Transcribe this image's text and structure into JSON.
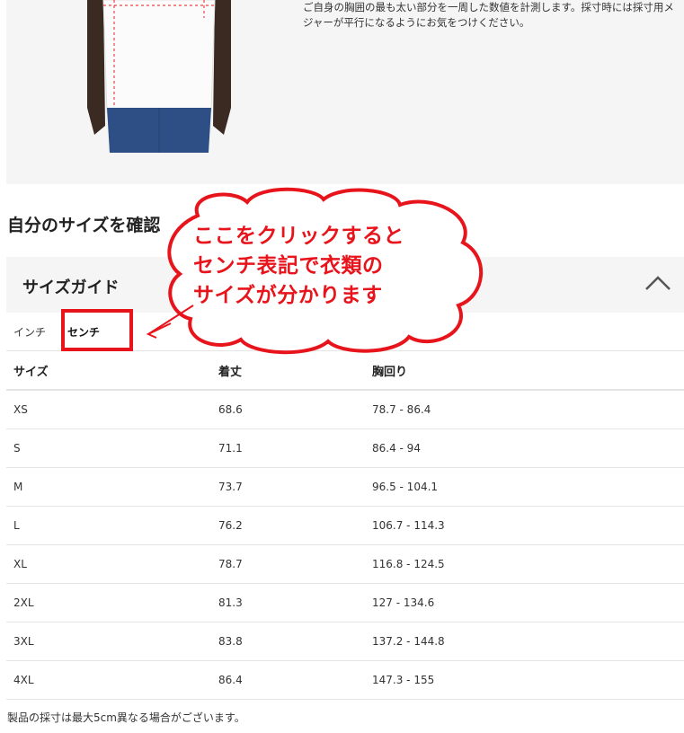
{
  "measure_instructions": "ご自身の胸囲の最も太い部分を一周した数値を計測します。採寸時には採寸用メジャーが平行になるようにお気をつけください。",
  "section_title": "自分のサイズを確認",
  "size_guide": {
    "title": "サイズガイド",
    "collapse_icon": "chevron-up-icon",
    "tabs": [
      "インチ",
      "センチ"
    ],
    "selected_tab": "センチ",
    "columns": [
      "サイズ",
      "着丈",
      "胸回り"
    ],
    "rows": [
      [
        "XS",
        "68.6",
        "78.7 - 86.4"
      ],
      [
        "S",
        "71.1",
        "86.4 - 94"
      ],
      [
        "M",
        "73.7",
        "96.5 - 104.1"
      ],
      [
        "L",
        "76.2",
        "106.7 - 114.3"
      ],
      [
        "XL",
        "78.7",
        "116.8 - 124.5"
      ],
      [
        "2XL",
        "81.3",
        "127 - 134.6"
      ],
      [
        "3XL",
        "83.8",
        "137.2 - 144.8"
      ],
      [
        "4XL",
        "86.4",
        "147.3 - 155"
      ]
    ],
    "footnote": "製品の採寸は最大5cm異なる場合がございます。"
  },
  "annotation": {
    "lines": [
      "ここをクリックすると",
      "センチ表記で衣類の",
      "サイズが分かります"
    ],
    "color": "#e8141c"
  }
}
